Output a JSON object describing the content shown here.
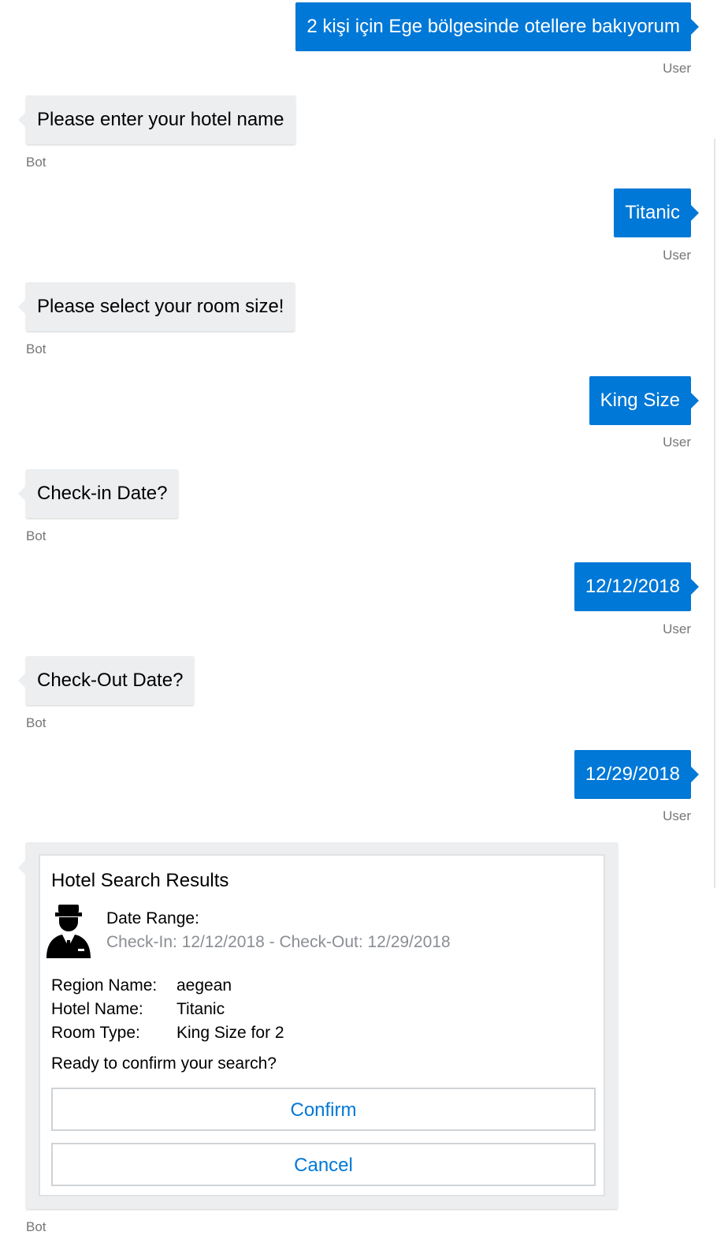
{
  "messages": [
    {
      "from": "user",
      "text": "2 kişi için Ege bölgesinde otellere bakıyorum",
      "sender": "User"
    },
    {
      "from": "bot",
      "text": "Please enter your hotel name",
      "sender": "Bot"
    },
    {
      "from": "user",
      "text": "Titanic",
      "sender": "User"
    },
    {
      "from": "bot",
      "text": "Please select your room size!",
      "sender": "Bot"
    },
    {
      "from": "user",
      "text": "King Size",
      "sender": "User"
    },
    {
      "from": "bot",
      "text": "Check-in Date?",
      "sender": "Bot"
    },
    {
      "from": "user",
      "text": "12/12/2018",
      "sender": "User"
    },
    {
      "from": "bot",
      "text": "Check-Out Date?",
      "sender": "Bot"
    },
    {
      "from": "user",
      "text": "12/29/2018",
      "sender": "User"
    }
  ],
  "card": {
    "title": "Hotel Search Results",
    "icon": "concierge-icon",
    "date_range_label": "Date Range:",
    "date_range_value": "Check-In: 12/12/2018 - Check-Out: 12/29/2018",
    "facts": [
      {
        "key": "Region Name:",
        "value": "aegean"
      },
      {
        "key": "Hotel Name:",
        "value": "Titanic"
      },
      {
        "key": "Room Type:",
        "value": "King Size for 2"
      }
    ],
    "prompt": "Ready to confirm your search?",
    "confirm_label": "Confirm",
    "cancel_label": "Cancel",
    "sender": "Bot"
  },
  "colors": {
    "user_bubble": "#0078d7",
    "bot_bubble": "#eceef0",
    "button_text": "#0078d7",
    "muted_text": "#767676"
  }
}
